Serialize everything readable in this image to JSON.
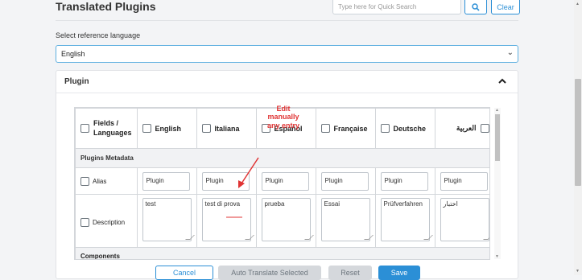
{
  "header": {
    "title": "Translated Plugins",
    "search_placeholder": "Type here for Quick Search",
    "clear_label": "Clear",
    "search_icon": "magnifier-icon"
  },
  "reference": {
    "label": "Select reference language",
    "selected": "English"
  },
  "plugin_section": {
    "title": "Plugin",
    "collapse_icon": "chevron-up-icon"
  },
  "grid": {
    "corner_label_line1": "Fields /",
    "corner_label_line2": "Languages",
    "languages": [
      "English",
      "Italiana",
      "Español",
      "Française",
      "Deutsche",
      "العربية"
    ],
    "metadata_section": "Plugins Metadata",
    "alias_label": "Alias",
    "alias_values": [
      "Plugin",
      "Plugin",
      "Plugin",
      "Plugin",
      "Plugin",
      "Plugin"
    ],
    "description_label": "Description",
    "description_values": [
      "test",
      "test di prova",
      "prueba",
      "Essai",
      "Prüfverfahren",
      "اختبار"
    ],
    "components_section": "Components"
  },
  "annotation": {
    "line1": "Edit",
    "line2": "manually",
    "line3": "any entry",
    "color": "#e03434"
  },
  "footer": {
    "cancel": "Cancel",
    "auto_translate": "Auto Translate Selected",
    "reset": "Reset",
    "save": "Save"
  },
  "colors": {
    "accent": "#2b8fd6",
    "disabled": "#d5d8dc"
  }
}
